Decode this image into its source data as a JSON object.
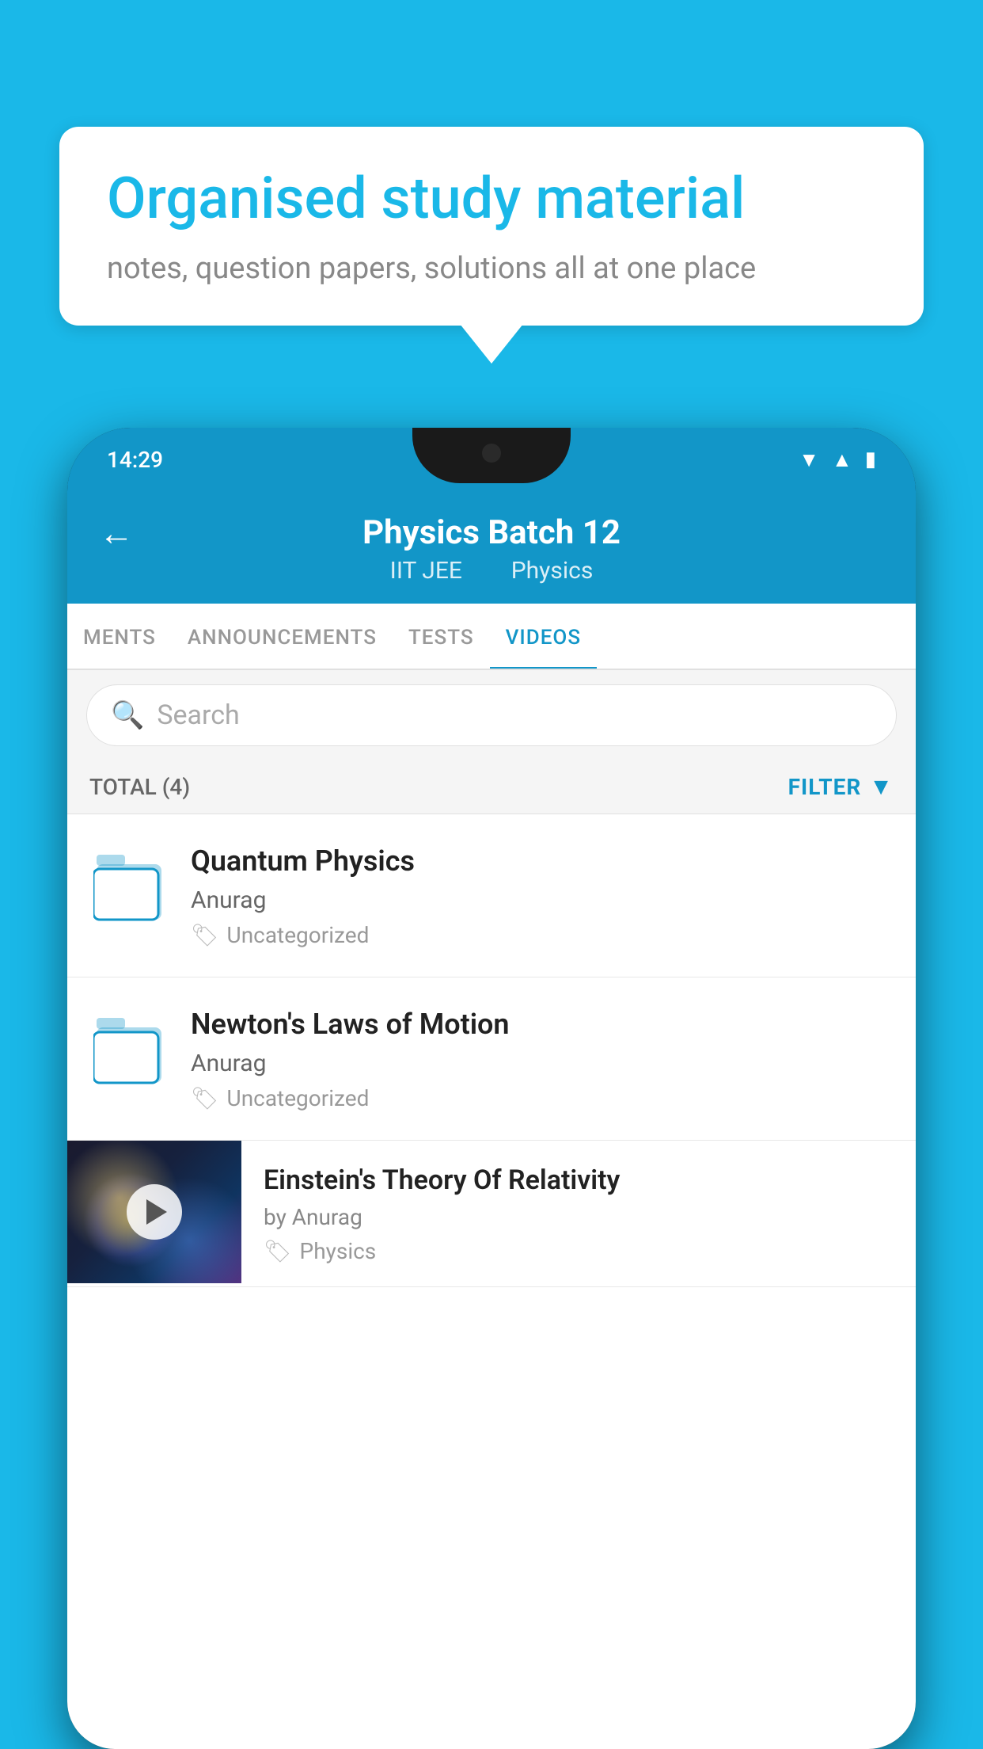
{
  "background_color": "#1ab8e8",
  "bubble": {
    "title": "Organised study material",
    "subtitle": "notes, question papers, solutions all at one place"
  },
  "phone": {
    "status_bar": {
      "time": "14:29",
      "icons": [
        "wifi",
        "signal",
        "battery"
      ]
    },
    "header": {
      "back_label": "←",
      "title": "Physics Batch 12",
      "subtitle_parts": [
        "IIT JEE",
        "Physics"
      ]
    },
    "tabs": [
      {
        "label": "MENTS",
        "active": false
      },
      {
        "label": "ANNOUNCEMENTS",
        "active": false
      },
      {
        "label": "TESTS",
        "active": false
      },
      {
        "label": "VIDEOS",
        "active": true
      }
    ],
    "search": {
      "placeholder": "Search"
    },
    "filter": {
      "total_label": "TOTAL (4)",
      "button_label": "FILTER"
    },
    "videos": [
      {
        "type": "folder",
        "title": "Quantum Physics",
        "author": "Anurag",
        "tag": "Uncategorized"
      },
      {
        "type": "folder",
        "title": "Newton's Laws of Motion",
        "author": "Anurag",
        "tag": "Uncategorized"
      },
      {
        "type": "thumbnail",
        "title": "Einstein's Theory Of Relativity",
        "author": "by Anurag",
        "tag": "Physics"
      }
    ]
  }
}
